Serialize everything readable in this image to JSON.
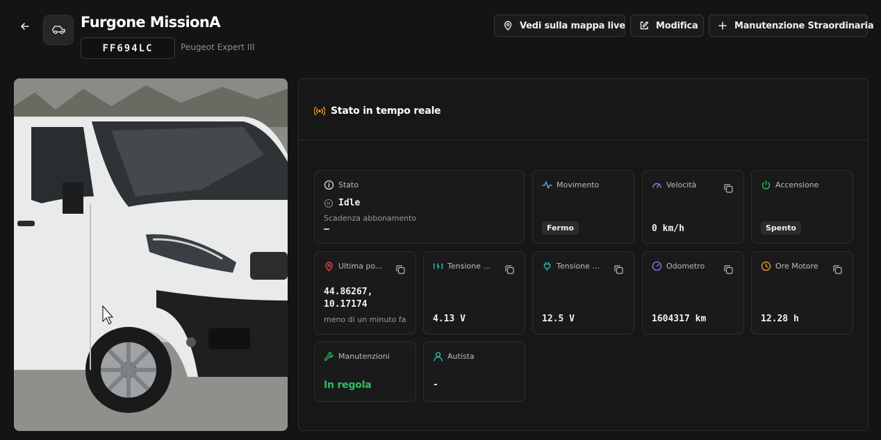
{
  "header": {
    "title": "Furgone MissionA",
    "plate": "FF694LC",
    "model": "Peugeot Expert III",
    "buttons": {
      "map": "Vedi sulla mappa live",
      "edit": "Modifica",
      "maintenance": "Manutenzione Straordinaria"
    }
  },
  "panel": {
    "title": "Stato in tempo reale"
  },
  "cards": {
    "stato": {
      "label": "Stato",
      "value": "Idle",
      "sub_label": "Scadenza abbonamento",
      "sub_value": "—"
    },
    "movimento": {
      "label": "Movimento",
      "badge": "Fermo"
    },
    "velocita": {
      "label": "Velocità",
      "value": "0 km/h"
    },
    "accensione": {
      "label": "Accensione",
      "badge": "Spento"
    },
    "posizione": {
      "label": "Ultima po...",
      "value_line1": "44.86267,",
      "value_line2": "10.17174",
      "sub": "meno di un minuto fa"
    },
    "tensione1": {
      "label": "Tensione ...",
      "value": "4.13 V"
    },
    "tensione2": {
      "label": "Tensione ...",
      "value": "12.5 V"
    },
    "odometro": {
      "label": "Odometro",
      "value": "1604317 km"
    },
    "ore_motore": {
      "label": "Ore Motore",
      "value": "12.28 h"
    },
    "manutenzioni": {
      "label": "Manutenzioni",
      "value": "In regola"
    },
    "autista": {
      "label": "Autista",
      "value": "-"
    }
  },
  "colors": {
    "background": "#141414",
    "accent_orange": "#f0a92e",
    "accent_teal": "#2ec4b6",
    "accent_blue": "#5aa9f0",
    "accent_green": "#22c55e",
    "accent_red": "#e5484d",
    "accent_purple": "#8b7cf6"
  },
  "icons": {
    "back": "arrow-left-icon",
    "vehicle": "car-icon",
    "map": "map-pin-icon",
    "edit": "pencil-square-icon",
    "add": "plus-icon",
    "live": "broadcast-icon",
    "copy": "copy-icon"
  }
}
